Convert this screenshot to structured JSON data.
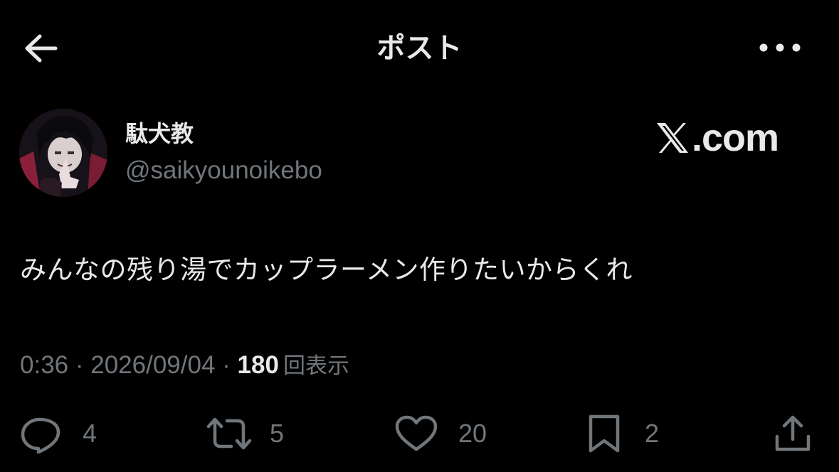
{
  "header": {
    "title": "ポスト",
    "back_icon": "arrow-left-icon",
    "more_icon": "more-horizontal-icon"
  },
  "author": {
    "display_name": "駄犬教",
    "handle": "@saikyounoikebo"
  },
  "watermark": {
    "text": ".com",
    "logo": "x-logo"
  },
  "post": {
    "text": "みんなの残り湯でカップラーメン作りたいからくれ"
  },
  "meta": {
    "time": "0:36",
    "separator": "·",
    "date": "2026/09/04",
    "views": "180",
    "views_label": "回表示"
  },
  "actions": {
    "reply": {
      "icon": "reply-icon",
      "count": "4"
    },
    "repost": {
      "icon": "repost-icon",
      "count": "5"
    },
    "like": {
      "icon": "heart-icon",
      "count": "20"
    },
    "bookmark": {
      "icon": "bookmark-icon",
      "count": "2"
    },
    "share": {
      "icon": "share-icon"
    }
  },
  "colors": {
    "background": "#000000",
    "text_primary": "#e7e9ea",
    "text_secondary": "#71767b"
  }
}
